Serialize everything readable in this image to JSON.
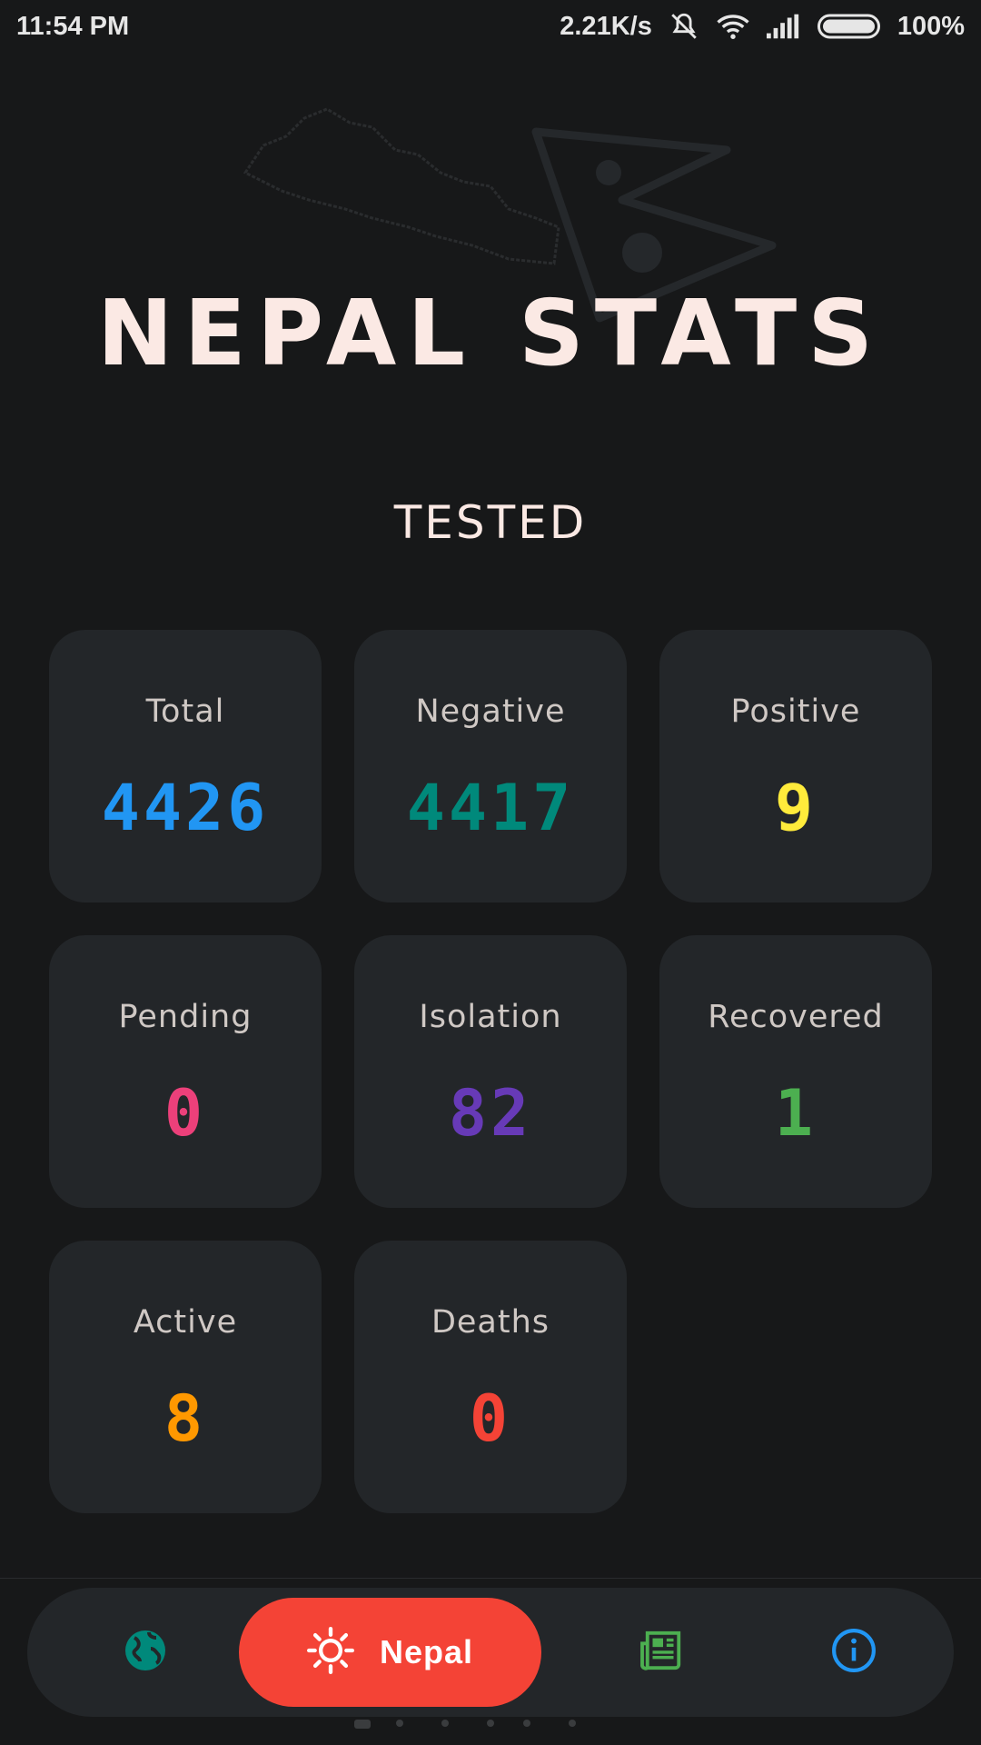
{
  "status_bar": {
    "time": "11:54 PM",
    "speed": "2.21K/s",
    "battery": "100%"
  },
  "header": {
    "title": "NEPAL STATS",
    "section": "TESTED"
  },
  "stats": [
    {
      "label": "Total",
      "value": "4426",
      "color": "#2196f3"
    },
    {
      "label": "Negative",
      "value": "4417",
      "color": "#00897b"
    },
    {
      "label": "Positive",
      "value": "9",
      "color": "#ffeb3b"
    },
    {
      "label": "Pending",
      "value": "0",
      "color": "#ec407a"
    },
    {
      "label": "Isolation",
      "value": "82",
      "color": "#673ab7"
    },
    {
      "label": "Recovered",
      "value": "1",
      "color": "#4caf50"
    },
    {
      "label": "Active",
      "value": "8",
      "color": "#ff9800"
    },
    {
      "label": "Deaths",
      "value": "0",
      "color": "#f44336"
    }
  ],
  "nav": {
    "items": [
      {
        "icon": "globe-icon",
        "color": "#00897b"
      },
      {
        "icon": "sun-icon",
        "label": "Nepal",
        "active": true,
        "color": "#f44336"
      },
      {
        "icon": "newspaper-icon",
        "color": "#4caf50"
      },
      {
        "icon": "info-icon",
        "color": "#2196f3"
      }
    ]
  }
}
